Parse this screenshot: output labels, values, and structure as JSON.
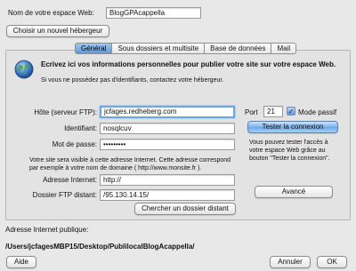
{
  "site_name": {
    "label": "Nom de votre espace Web:",
    "value": "BlogGPAcappella"
  },
  "choose_host_button": "Choisir un nouvel hébergeur",
  "tabs": [
    {
      "label": "Général",
      "active": true
    },
    {
      "label": "Sous dossiers et multisite",
      "active": false
    },
    {
      "label": "Base de données",
      "active": false
    },
    {
      "label": "Mail",
      "active": false
    }
  ],
  "intro": {
    "icon": "earth-globe-icon",
    "heading": "Ecrivez ici vos informations personnelles pour publier votre site sur votre espace Web.",
    "subtext": "Si vous ne possédez pas d'identifiants, contactez votre hébergeur."
  },
  "ftp": {
    "host_label": "Hôte (serveur FTP):",
    "host_value": "jcfages.redheberg.com",
    "port_label": "Port",
    "port_value": "21",
    "passive_label": "Mode passif",
    "passive_checked": true,
    "id_label": "Identifiant:",
    "id_value": "nosqlcuv",
    "password_label": "Mot de passe:",
    "password_value": "•••••••••",
    "test_button": "Tester la connexion",
    "test_help": "Vous pouvez tester l'accès à votre espace Web grâce au bouton \"Tester la connexion\"."
  },
  "visibility_note": "Votre site sera visible à cette adresse Internet. Cette adresse correspond par exemple à votre nom de domaine ( http://www.monsite.fr ).",
  "internet_address": {
    "label": "Adresse Internet:",
    "value": "http://"
  },
  "remote_folder": {
    "label": "Dossier FTP distant:",
    "value": "/95.130.14.15/"
  },
  "search_remote_button": "Chercher un dossier distant",
  "advanced_button": "Avancé",
  "public_address": {
    "label": "Adresse Internet publique:",
    "path": "/Users/jcfagesMBP15/Desktop/PublilocalBlogAcappella/"
  },
  "footer": {
    "help": "Aide",
    "cancel": "Annuler",
    "ok": "OK"
  },
  "colors": {
    "accent": "#6aa7ea",
    "focus_ring": "#6ea4df",
    "background": "#e8e8e8"
  }
}
